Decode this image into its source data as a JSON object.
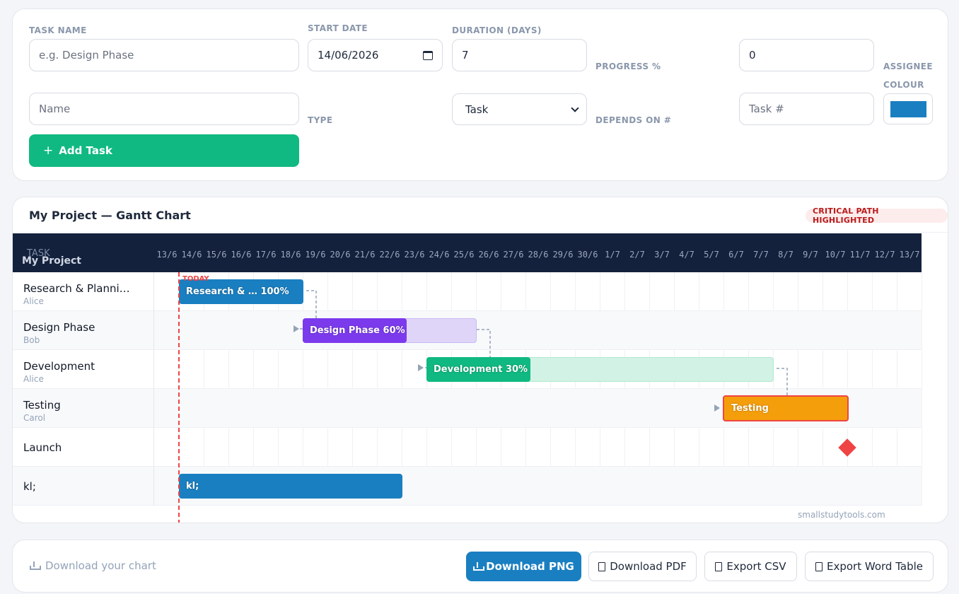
{
  "form": {
    "task_name_label": "TASK NAME",
    "task_name_placeholder": "e.g. Design Phase",
    "start_date_label": "START DATE",
    "start_date_value": "14/06/2026",
    "duration_label": "DURATION (DAYS)",
    "duration_value": "7",
    "progress_label": "PROGRESS %",
    "progress_value": "0",
    "assignee_label": "ASSIGNEE",
    "assignee_placeholder": "Name",
    "type_label": "TYPE",
    "type_value": "Task",
    "depends_label": "DEPENDS ON #",
    "depends_placeholder": "Task #",
    "colour_label": "COLOUR",
    "colour_value": "#1a7fc1",
    "add_button": "Add Task"
  },
  "chart": {
    "title": "My Project — Gantt Chart",
    "badge": "CRITICAL PATH HIGHLIGHTED",
    "header_task": "TASK",
    "header_project": "My Project",
    "today_label": "TODAY",
    "watermark": "smallstudytools.com",
    "dates": [
      "13/6",
      "14/6",
      "15/6",
      "16/6",
      "17/6",
      "18/6",
      "19/6",
      "20/6",
      "21/6",
      "22/6",
      "23/6",
      "24/6",
      "25/6",
      "26/6",
      "27/6",
      "28/6",
      "29/6",
      "30/6",
      "1/7",
      "2/7",
      "3/7",
      "4/7",
      "5/7",
      "6/7",
      "7/7",
      "8/7",
      "9/7",
      "10/7",
      "11/7",
      "12/7",
      "13/7"
    ]
  },
  "tasks": [
    {
      "name": "Research & Planni…",
      "assignee": "Alice",
      "bar_label": "Research & … 100%",
      "color": "#1a7fc1"
    },
    {
      "name": "Design Phase",
      "assignee": "Bob",
      "bar_label": "Design Phase 60%",
      "color": "#7c3aed"
    },
    {
      "name": "Development",
      "assignee": "Alice",
      "bar_label": "Development 30%",
      "color": "#10b981"
    },
    {
      "name": "Testing",
      "assignee": "Carol",
      "bar_label": "Testing",
      "color": "#f59e0b"
    },
    {
      "name": "Launch",
      "assignee": "",
      "bar_label": "",
      "color": "#ef4444"
    },
    {
      "name": "kl;",
      "assignee": "",
      "bar_label": "kl;",
      "color": "#1a7fc1"
    }
  ],
  "export": {
    "hint": "Download your chart",
    "png": "Download PNG",
    "pdf": "Download PDF",
    "csv": "Export CSV",
    "word": "Export Word Table"
  }
}
